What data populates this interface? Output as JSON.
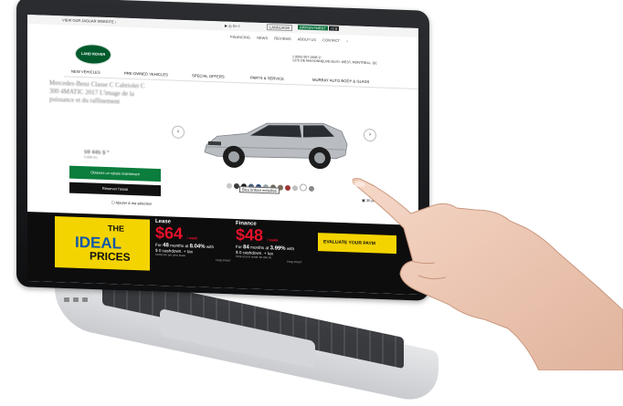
{
  "topbar": {
    "visit_text": "VIEW OUR JAGUAR WEBSITE ›",
    "social": "▶ ◎ G+ f",
    "lang": "LANGUAGE",
    "appt": "APPOINTMENT",
    "cart_count": "0"
  },
  "links": [
    "FINANCING",
    "NEWS",
    "REVIEWS",
    "ABOUT US",
    "CONTACT"
  ],
  "phone": "1 (855) 957-2695 ✆\n1375 DE MAISONNEUVE BLVD. WEST, MONTREAL, QC",
  "logo": "LAND ROVER",
  "nav": [
    "NEW VEHICLES",
    "PRE-OWNED VEHICLES",
    "SPECIAL OFFERS",
    "PARTS & SERVICE",
    "MURRAY AUTO BODY & GLASS"
  ],
  "vehicle": {
    "title": "Mercedes-Benz Classe C Cabriolet C 300 4MATIC 2017 L'image de la puissance et du raffinement",
    "price": "59 445 $ *",
    "price_note": "Coûts inc.",
    "btn_primary": "Obtenez un rabais maintenant",
    "btn_secondary": "Réserver l'essai",
    "compare": "Ajouter à ma sélection",
    "color_name": "Bleu brillant métallisé",
    "photos": "▣ 30 photos"
  },
  "colors": [
    "#c9c9c9",
    "#3b3b3b",
    "#1c1c1c",
    "#4a5f7a",
    "#2f4a7a",
    "#9aa3a8",
    "#6c6a5f",
    "#7b6c5a",
    "#a03535",
    "#c0c0c0",
    "#ffffff",
    "#8a8a8a"
  ],
  "banner": {
    "ideal_the": "THE",
    "ideal_ideal": "IDEAL",
    "ideal_prices": "PRICES",
    "lease": {
      "label": "Lease",
      "amount": "$64",
      "per": "/ week",
      "line1_pre": "For ",
      "months": "48",
      "line1_mid": " months at ",
      "rate": "8.04%",
      "line1_post": " with",
      "line2": "$ 0 cashdown. + tax",
      "line3": "16000 km per year lease",
      "fine": "FINE PRINT"
    },
    "finance": {
      "label": "Finance",
      "amount": "$48",
      "per": "/ week",
      "line1_pre": "For ",
      "months": "84",
      "line1_mid": " months at ",
      "rate": "3.99%",
      "line1_post": " with",
      "line2": "$ 0 cashdown. + tax",
      "line3": "Total cost of credit: $2,090.50",
      "fine": "FINE PRINT"
    },
    "evaluate": "EVALUATE YOUR PAYM"
  }
}
